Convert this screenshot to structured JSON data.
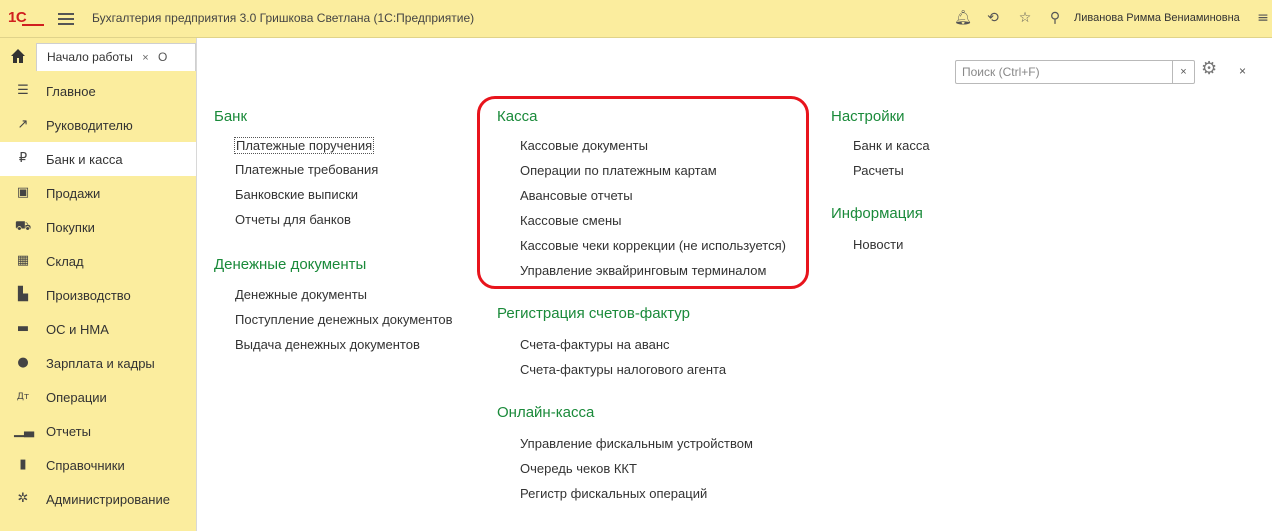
{
  "titlebar": {
    "logo": "1С",
    "title": "Бухгалтерия предприятия 3.0 Гришкова Светлана  (1С:Предприятие)",
    "username": "Ливанова Римма Вениаминовна",
    "icons": [
      "bell-icon",
      "history-icon",
      "star-icon",
      "search-icon",
      "menu-icon"
    ]
  },
  "tabbar": {
    "tab_label": "Начало работы",
    "tab_close": "×",
    "next_tab_partial": "О"
  },
  "sidebar": {
    "items": [
      {
        "label": "Главное",
        "icon": "list-icon"
      },
      {
        "label": "Руководителю",
        "icon": "trend-icon"
      },
      {
        "label": "Банк и касса",
        "icon": "ruble-icon",
        "active": true
      },
      {
        "label": "Продажи",
        "icon": "bag-icon"
      },
      {
        "label": "Покупки",
        "icon": "cart-icon"
      },
      {
        "label": "Склад",
        "icon": "warehouse-icon"
      },
      {
        "label": "Производство",
        "icon": "production-icon"
      },
      {
        "label": "ОС и НМА",
        "icon": "truck-icon"
      },
      {
        "label": "Зарплата и кадры",
        "icon": "person-icon"
      },
      {
        "label": "Операции",
        "icon": "dt-kt-icon"
      },
      {
        "label": "Отчеты",
        "icon": "bar-chart-icon"
      },
      {
        "label": "Справочники",
        "icon": "book-icon"
      },
      {
        "label": "Администрирование",
        "icon": "gear-icon"
      }
    ]
  },
  "search": {
    "placeholder": "Поиск (Ctrl+F)",
    "clear": "×"
  },
  "main_close": "×",
  "sections": {
    "bank": {
      "title": "Банк",
      "links": [
        "Платежные поручения",
        "Платежные требования",
        "Банковские выписки",
        "Отчеты для банков"
      ]
    },
    "money_docs": {
      "title": "Денежные документы",
      "links": [
        "Денежные документы",
        "Поступление денежных документов",
        "Выдача денежных документов"
      ]
    },
    "kassa": {
      "title": "Касса",
      "links": [
        "Кассовые документы",
        "Операции по платежным картам",
        "Авансовые отчеты",
        "Кассовые смены",
        "Кассовые чеки коррекции (не используется)",
        "Управление эквайринговым терминалом"
      ]
    },
    "invoices": {
      "title": "Регистрация счетов-фактур",
      "links": [
        "Счета-фактуры на аванс",
        "Счета-фактуры налогового агента"
      ]
    },
    "online_kassa": {
      "title": "Онлайн-касса",
      "links": [
        "Управление фискальным устройством",
        "Очередь чеков ККТ",
        "Регистр фискальных операций"
      ]
    },
    "settings": {
      "title": "Настройки",
      "links": [
        "Банк и касса",
        "Расчеты"
      ]
    },
    "info": {
      "title": "Информация",
      "links": [
        "Новости"
      ]
    }
  },
  "colors": {
    "sidebar_bg": "#fbed9e",
    "section_title": "#1a8a3a",
    "highlight": "#e8141c",
    "logo": "#d01f1f"
  }
}
